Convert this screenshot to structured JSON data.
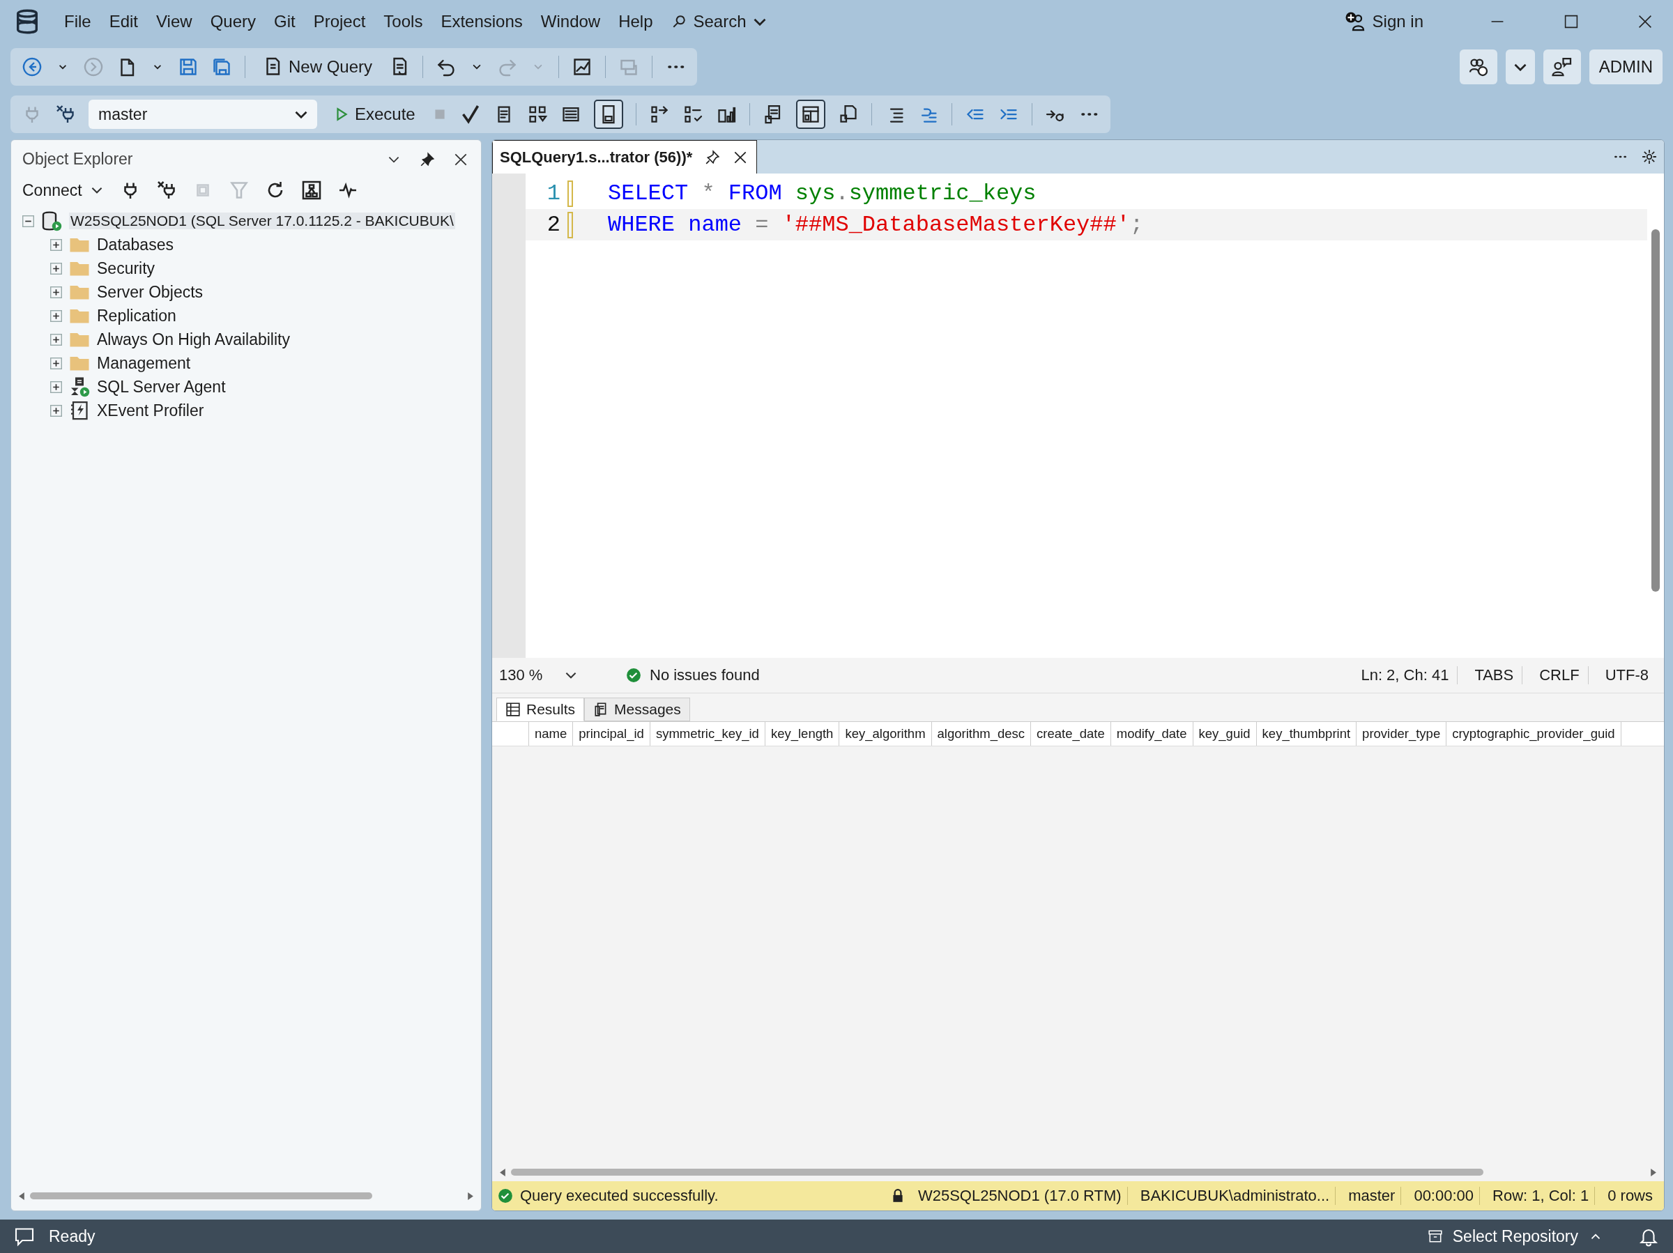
{
  "menu": [
    "File",
    "Edit",
    "View",
    "Query",
    "Git",
    "Project",
    "Tools",
    "Extensions",
    "Window",
    "Help"
  ],
  "search": {
    "label": "Search"
  },
  "account": {
    "sign_in": "Sign in",
    "user": "ADMIN"
  },
  "toolbar": {
    "new_query": "New Query",
    "database": "master",
    "execute": "Execute"
  },
  "object_explorer": {
    "title": "Object Explorer",
    "connect": "Connect",
    "tree": [
      {
        "label": "W25SQL25NOD1 (SQL Server 17.0.1125.2 - BAKICUBUK\\",
        "kind": "server",
        "expanded": true,
        "selected": true,
        "children": [
          {
            "label": "Databases",
            "kind": "folder",
            "expanded": false,
            "selected": false
          },
          {
            "label": "Security",
            "kind": "folder",
            "expanded": false,
            "selected": false
          },
          {
            "label": "Server Objects",
            "kind": "folder",
            "expanded": false,
            "selected": false
          },
          {
            "label": "Replication",
            "kind": "folder",
            "expanded": false,
            "selected": false
          },
          {
            "label": "Always On High Availability",
            "kind": "folder",
            "expanded": false,
            "selected": false
          },
          {
            "label": "Management",
            "kind": "folder",
            "expanded": false,
            "selected": false
          },
          {
            "label": "SQL Server Agent",
            "kind": "agent",
            "expanded": false,
            "selected": false
          },
          {
            "label": "XEvent Profiler",
            "kind": "profiler",
            "expanded": false,
            "selected": false
          }
        ]
      }
    ]
  },
  "editor_tabs": [
    {
      "title": "SQLQuery1.s...trator (56))*",
      "selected": true
    }
  ],
  "code_lines": [
    {
      "number": "1",
      "current": false,
      "tokens": [
        {
          "kind": "keyword",
          "text": "SELECT"
        },
        {
          "kind": "operator",
          "text": " * "
        },
        {
          "kind": "keyword",
          "text": "FROM"
        },
        {
          "kind": "object",
          "text": " sys"
        },
        {
          "kind": "operator",
          "text": "."
        },
        {
          "kind": "object",
          "text": "symmetric_keys"
        }
      ]
    },
    {
      "number": "2",
      "current": true,
      "tokens": [
        {
          "kind": "keyword",
          "text": "WHERE"
        },
        {
          "kind": "keyword",
          "text": " name"
        },
        {
          "kind": "operator",
          "text": " = "
        },
        {
          "kind": "string",
          "text": "'##MS_DatabaseMasterKey##'"
        },
        {
          "kind": "operator",
          "text": ";"
        }
      ]
    }
  ],
  "editor_status": {
    "zoom": "130 %",
    "issues": "No issues found",
    "position": "Ln: 2, Ch: 41",
    "indent": "TABS",
    "line_endings": "CRLF",
    "encoding": "UTF-8"
  },
  "result_tabs": [
    {
      "label": "Results",
      "kind": "grid",
      "selected": true
    },
    {
      "label": "Messages",
      "kind": "messages",
      "selected": false
    }
  ],
  "result_columns": [
    "name",
    "principal_id",
    "symmetric_key_id",
    "key_length",
    "key_algorithm",
    "algorithm_desc",
    "create_date",
    "modify_date",
    "key_guid",
    "key_thumbprint",
    "provider_type",
    "cryptographic_provider_guid"
  ],
  "query_status": {
    "message": "Query executed successfully.",
    "server": "W25SQL25NOD1 (17.0 RTM)",
    "user": "BAKICUBUK\\administrato...",
    "database": "master",
    "elapsed": "00:00:00",
    "cursor": "Row: 1, Col: 1",
    "rows": "0 rows"
  },
  "status_bar": {
    "state": "Ready",
    "repository": "Select Repository"
  }
}
